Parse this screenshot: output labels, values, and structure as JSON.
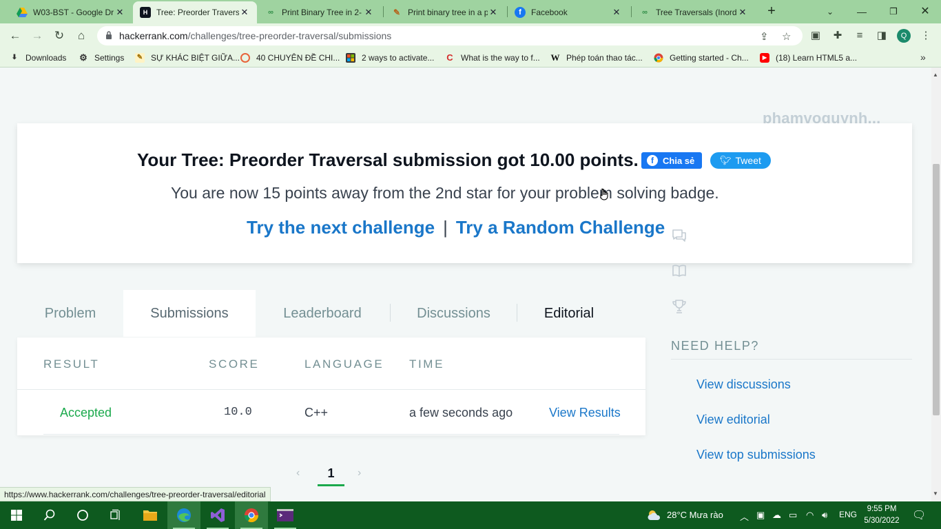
{
  "browser": {
    "tabs": [
      {
        "title": "W03-BST - Google Dr",
        "favicon": "google-drive-icon",
        "active": false
      },
      {
        "title": "Tree: Preorder Traversa",
        "favicon": "hackerrank-icon",
        "active": true
      },
      {
        "title": "Print Binary Tree in 2-",
        "favicon": "geeksforgeeks-icon",
        "active": false
      },
      {
        "title": "Print binary tree in a p",
        "favicon": "pen-icon",
        "active": false
      },
      {
        "title": "Facebook",
        "favicon": "facebook-icon",
        "active": false
      },
      {
        "title": "Tree Traversals (Inorde",
        "favicon": "geeksforgeeks-icon",
        "active": false
      }
    ],
    "url_host": "hackerrank.com",
    "url_path": "/challenges/tree-preorder-traversal/submissions",
    "profile_initial": "Q",
    "bookmarks": [
      {
        "label": "Downloads",
        "icon": "download-icon"
      },
      {
        "label": "Settings",
        "icon": "gear-icon"
      },
      {
        "label": "SỰ KHÁC BIỆT GIỮA...",
        "icon": "note-icon"
      },
      {
        "label": "40 CHUYÊN ĐỀ CHI...",
        "icon": "target-icon"
      },
      {
        "label": "2 ways to activate...",
        "icon": "windows-icon"
      },
      {
        "label": "What is the way to f...",
        "icon": "c-icon"
      },
      {
        "label": "Phép toán thao tác...",
        "icon": "wikipedia-icon"
      },
      {
        "label": "Getting started - Ch...",
        "icon": "chrome-icon"
      },
      {
        "label": "(18) Learn HTML5 a...",
        "icon": "youtube-icon"
      }
    ],
    "status_url": "https://www.hackerrank.com/challenges/tree-preorder-traversal/editorial"
  },
  "page": {
    "username": "phamvoquynh...",
    "banner": {
      "title": "Your Tree: Preorder Traversal submission got 10.00 points.",
      "share_label": "Chia sẻ",
      "tweet_label": "Tweet",
      "subtitle": "You are now 15 points away from the 2nd star for your problem solving badge.",
      "next_challenge": "Try the next challenge",
      "separator": "|",
      "random_challenge": "Try a Random Challenge"
    },
    "tabs": [
      "Problem",
      "Submissions",
      "Leaderboard",
      "Discussions",
      "Editorial"
    ],
    "active_tab": "Submissions",
    "table": {
      "headers": [
        "RESULT",
        "SCORE",
        "LANGUAGE",
        "TIME"
      ],
      "rows": [
        {
          "result": "Accepted",
          "score": "10.0",
          "language": "C++",
          "time": "a few seconds ago",
          "action": "View Results"
        }
      ]
    },
    "pagination": {
      "current": "1"
    },
    "help": {
      "title": "NEED HELP?",
      "links": [
        "View discussions",
        "View editorial",
        "View top submissions"
      ]
    }
  },
  "taskbar": {
    "weather": "28°C  Mưa rào",
    "language": "ENG",
    "time": "9:55 PM",
    "date": "5/30/2022"
  },
  "colors": {
    "accent_green": "#1ba94c",
    "link_blue": "#1a77c9",
    "browser_frame": "#9fd3a0",
    "taskbar": "#0e5a1f"
  }
}
